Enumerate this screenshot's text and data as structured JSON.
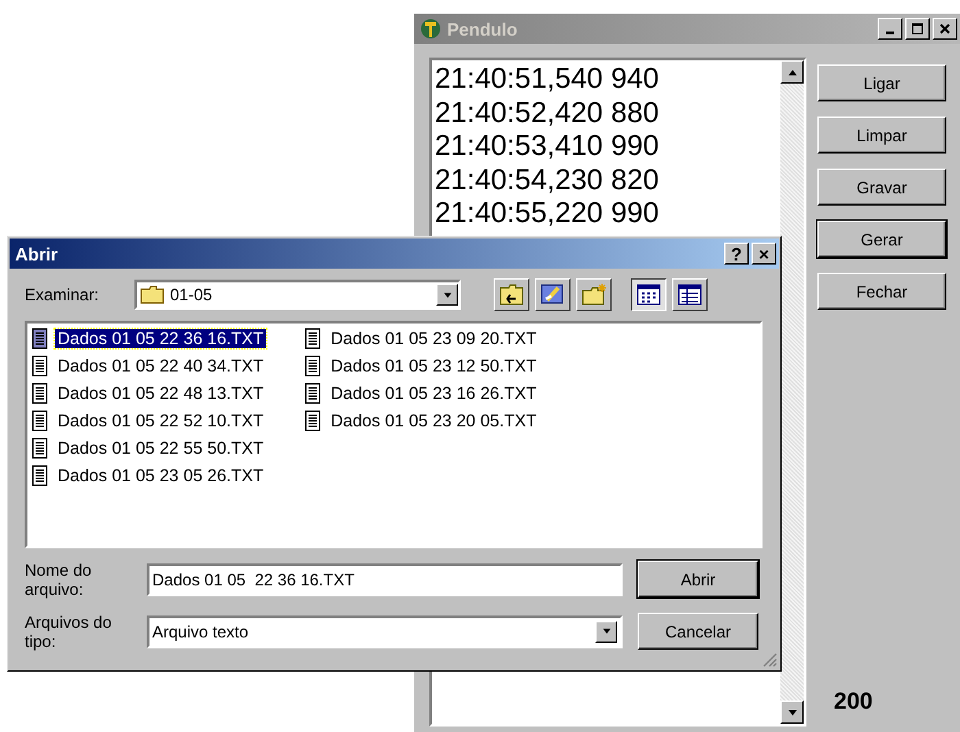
{
  "main_window": {
    "title": "Pendulo",
    "readings": [
      "21:40:51,540 940",
      "21:40:52,420 880",
      "21:40:53,410 990",
      "21:40:54,230 820",
      "21:40:55,220 990"
    ],
    "buttons": [
      {
        "label": "Ligar",
        "default": false
      },
      {
        "label": "Limpar",
        "default": false
      },
      {
        "label": "Gravar",
        "default": false
      },
      {
        "label": "Gerar",
        "default": true
      },
      {
        "label": "Fechar",
        "default": false
      }
    ],
    "count": "200"
  },
  "dialog": {
    "title": "Abrir",
    "help": "?",
    "close": "×",
    "look_in": {
      "label": "Examinar:",
      "value": "01-05"
    },
    "files": [
      {
        "name": "Dados 01 05 22 36 16.TXT",
        "selected": true
      },
      {
        "name": "Dados 01 05 22 40 34.TXT",
        "selected": false
      },
      {
        "name": "Dados 01 05 22 48 13.TXT",
        "selected": false
      },
      {
        "name": "Dados 01 05 22 52 10.TXT",
        "selected": false
      },
      {
        "name": "Dados 01 05 22 55 50.TXT",
        "selected": false
      },
      {
        "name": "Dados 01 05 23 05 26.TXT",
        "selected": false
      },
      {
        "name": "Dados 01 05 23 09 20.TXT",
        "selected": false
      },
      {
        "name": "Dados 01 05 23 12 50.TXT",
        "selected": false
      },
      {
        "name": "Dados 01 05 23 16 26.TXT",
        "selected": false
      },
      {
        "name": "Dados 01 05 23 20 05.TXT",
        "selected": false
      }
    ],
    "file_name": {
      "label_lines": [
        "Nome do",
        "arquivo:"
      ],
      "value": "Dados 01 05  22 36 16.TXT"
    },
    "file_type": {
      "label_lines": [
        "Arquivos do",
        "tipo:"
      ],
      "value": "Arquivo texto"
    },
    "buttons": [
      {
        "label": "Abrir",
        "default": true
      },
      {
        "label": "Cancelar",
        "default": false
      }
    ]
  }
}
